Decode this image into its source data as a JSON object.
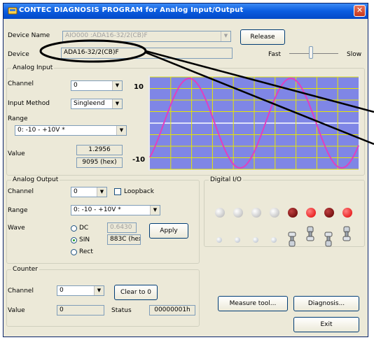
{
  "window": {
    "title": "CONTEC DIAGNOSIS PROGRAM for Analog Input/Output",
    "close_glyph": "✕"
  },
  "device": {
    "name_label": "Device Name",
    "name_value": "AIO000 :ADA16-32/2(CB)F",
    "release_label": "Release",
    "device_label": "Device",
    "device_value": "ADA16-32/2(CB)F",
    "speed_fast": "Fast",
    "speed_slow": "Slow"
  },
  "analog_input": {
    "title": "Analog Input",
    "channel_label": "Channel",
    "channel_value": "0",
    "method_label": "Input Method",
    "method_value": "Singleend",
    "range_label": "Range",
    "range_value": "0: -10 - +10V *",
    "value_label": "Value",
    "value": "1.2956",
    "hex": "9095 (hex)"
  },
  "graph": {
    "ymax_label": "10",
    "ymin_label": "-10",
    "trace_color": "#e040c0",
    "bg_color": "#7f86e6",
    "grid_color": "#e6e600"
  },
  "analog_output": {
    "title": "Analog Output",
    "channel_label": "Channel",
    "channel_value": "0",
    "loopback_label": "Loopback",
    "range_label": "Range",
    "range_value": "0: -10 - +10V *",
    "wave_label": "Wave",
    "dc_label": "DC",
    "dc_value": "0.6430",
    "sin_label": "SIN",
    "sin_value": "883C (hex)",
    "rect_label": "Rect",
    "apply_label": "Apply"
  },
  "digital_io": {
    "title": "Digital I/O",
    "outputs": [
      "off",
      "off",
      "off",
      "off",
      "dark-red",
      "red",
      "dark-red",
      "red"
    ],
    "inputs": [
      "off",
      "off",
      "off",
      "off",
      "toggle",
      "switch",
      "toggle",
      "switch"
    ]
  },
  "counter": {
    "title": "Counter",
    "channel_label": "Channel",
    "channel_value": "0",
    "clear_label": "Clear to 0",
    "value_label": "Value",
    "value": "0",
    "status_label": "Status",
    "status_value": "00000001h"
  },
  "actions": {
    "measure_label": "Measure tool...",
    "diagnosis_label": "Diagnosis...",
    "exit_label": "Exit"
  }
}
